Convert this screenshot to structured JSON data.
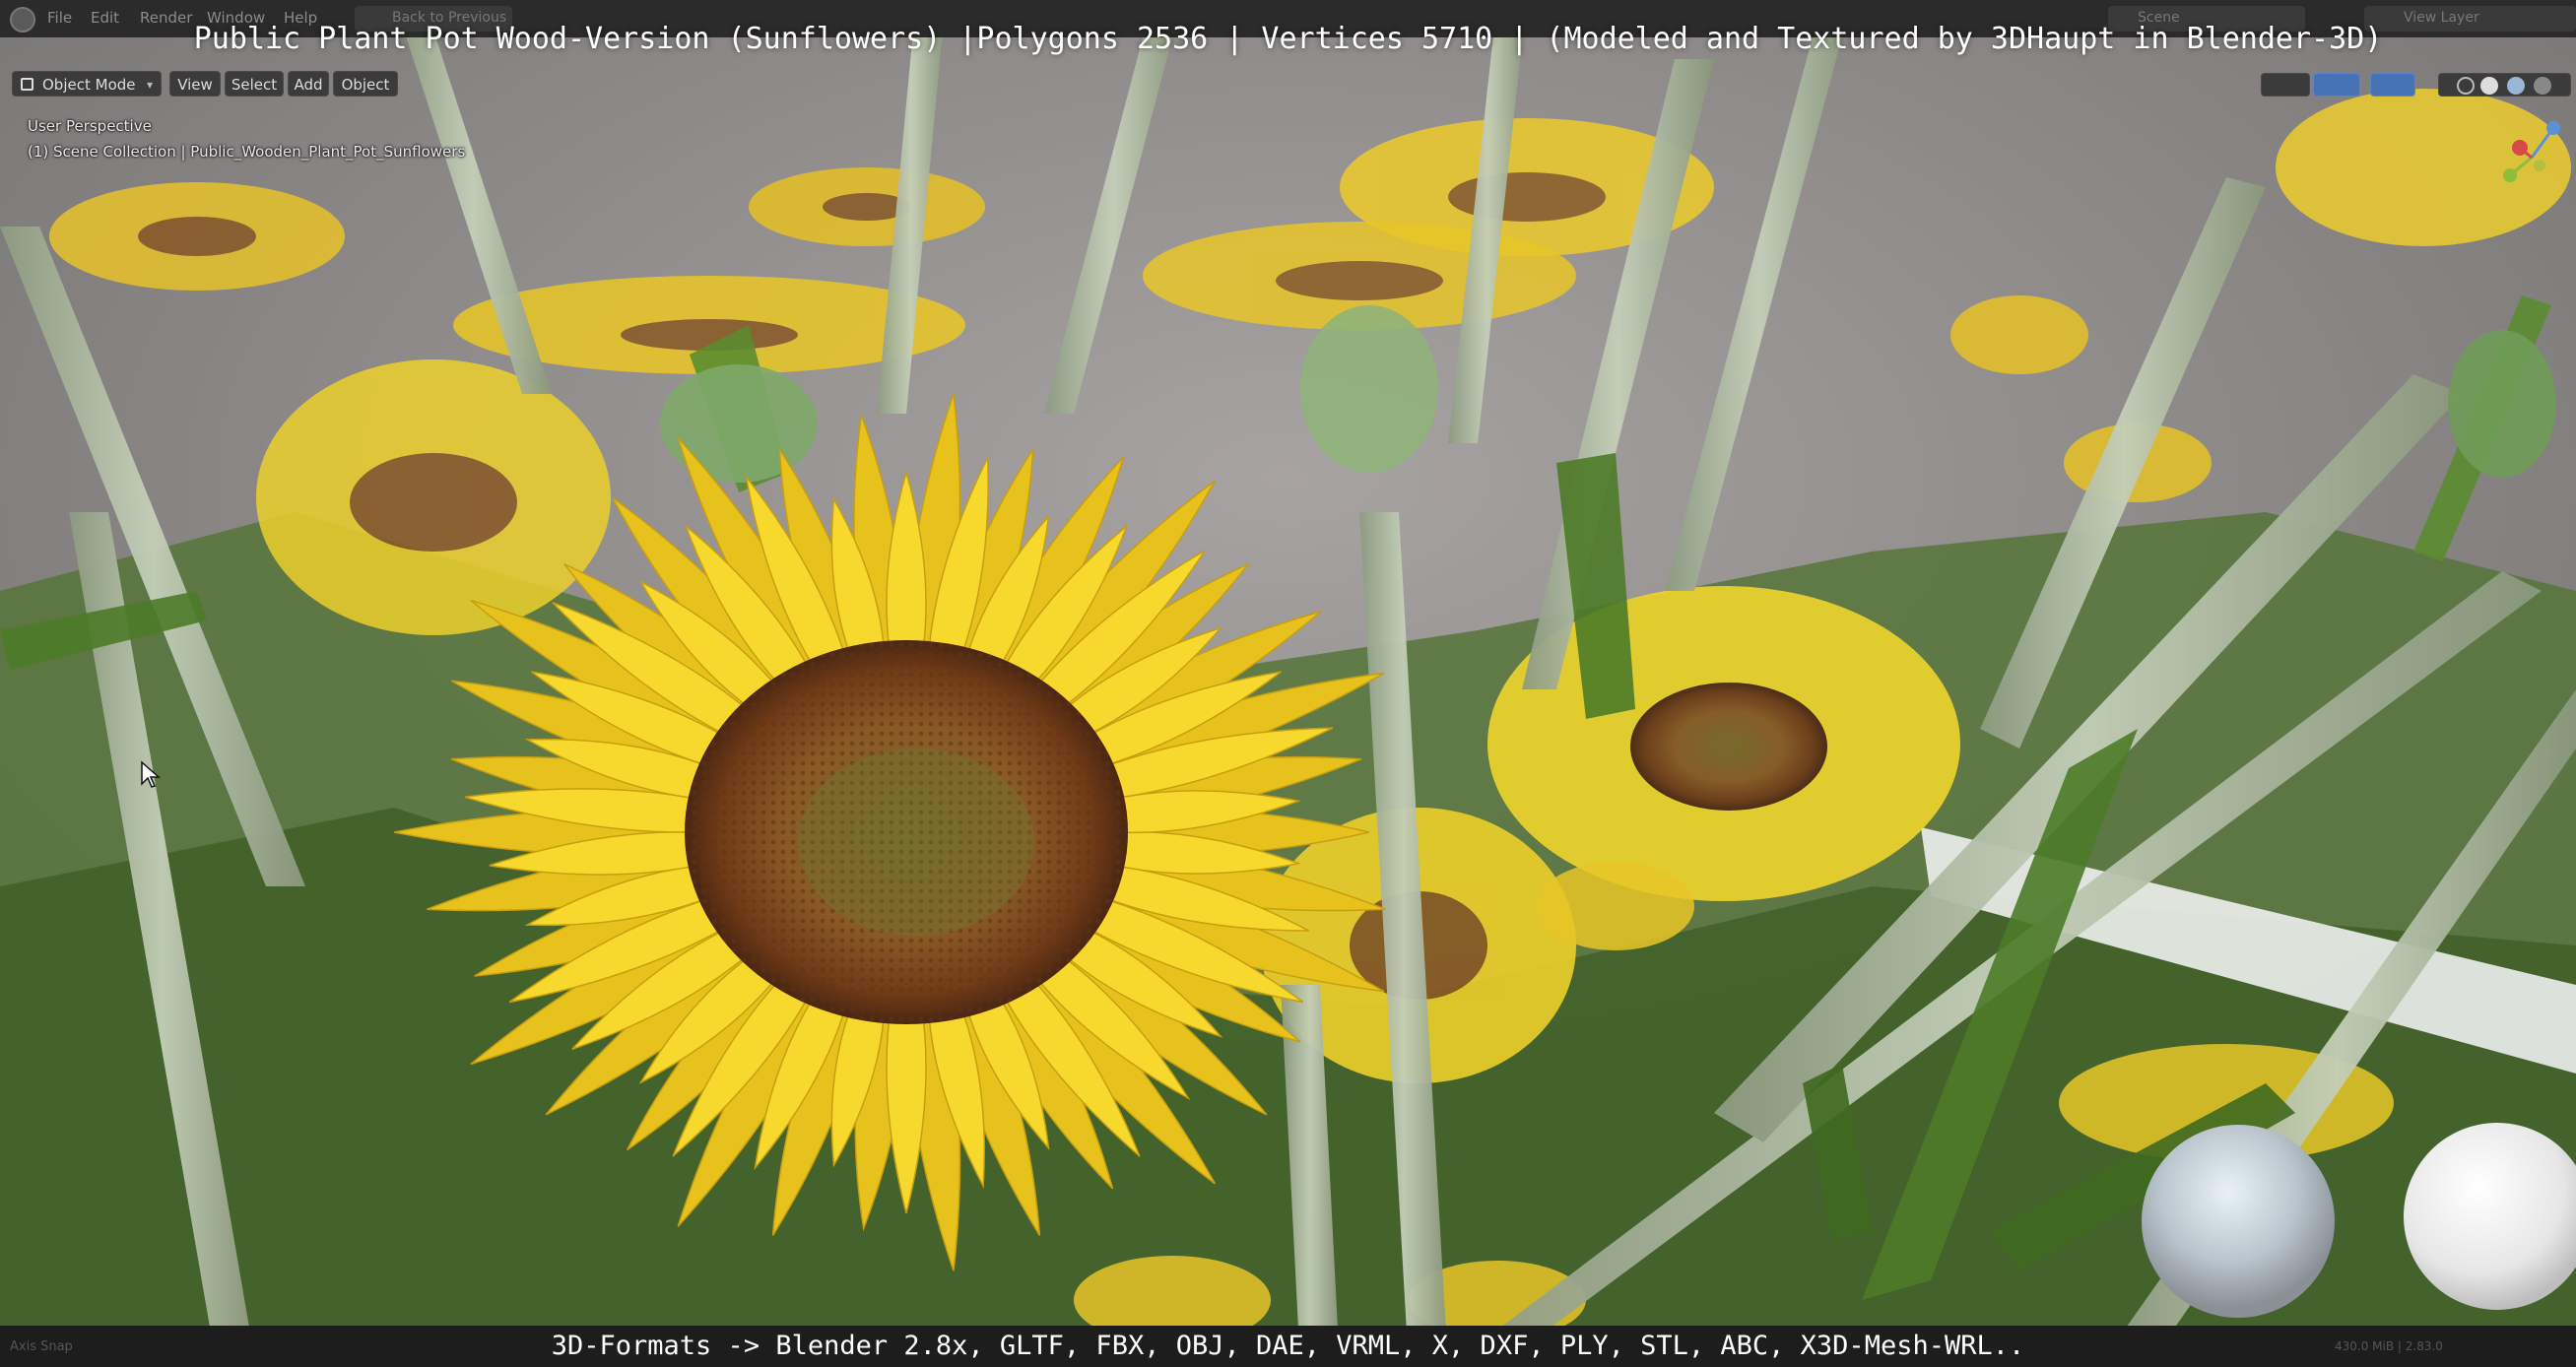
{
  "title_overlay": "Public Plant Pot Wood-Version (Sunflowers) |Polygons 2536 | Vertices 5710 | (Modeled and Textured by 3DHaupt in Blender-3D)",
  "bottom_overlay": "3D-Formats -> Blender 2.8x, GLTF, FBX, OBJ, DAE, VRML, X, DXF, PLY, STL, ABC, X3D-Mesh-WRL..",
  "menu": {
    "file": "File",
    "edit": "Edit",
    "render": "Render",
    "window": "Window",
    "help": "Help",
    "back_to_previous": "Back to Previous",
    "scene": "Scene",
    "view_layer": "View Layer"
  },
  "viewport_header": {
    "mode": "Object Mode",
    "view": "View",
    "select": "Select",
    "add": "Add",
    "object": "Object"
  },
  "viewport_info": {
    "perspective": "User Perspective",
    "collection": "(1) Scene Collection | Public_Wooden_Plant_Pot_Sunflowers"
  },
  "status": {
    "left": "Axis Snap",
    "right": "430.0 MiB | 2.83.0"
  },
  "icons": [
    "blender-logo-icon",
    "object-mode-icon",
    "navigation-gizmo-icon",
    "material-preview-sphere-icon",
    "mouse-cursor-icon"
  ],
  "colors": {
    "sunflower_petal": "#f2d21a",
    "sunflower_center": "#8a4a1e",
    "stem": "#a9b79a",
    "leaf": "#4f7a2a",
    "background": "#8b8686",
    "header_bg": "#2b2b2b",
    "active_blue": "#4772b3"
  }
}
